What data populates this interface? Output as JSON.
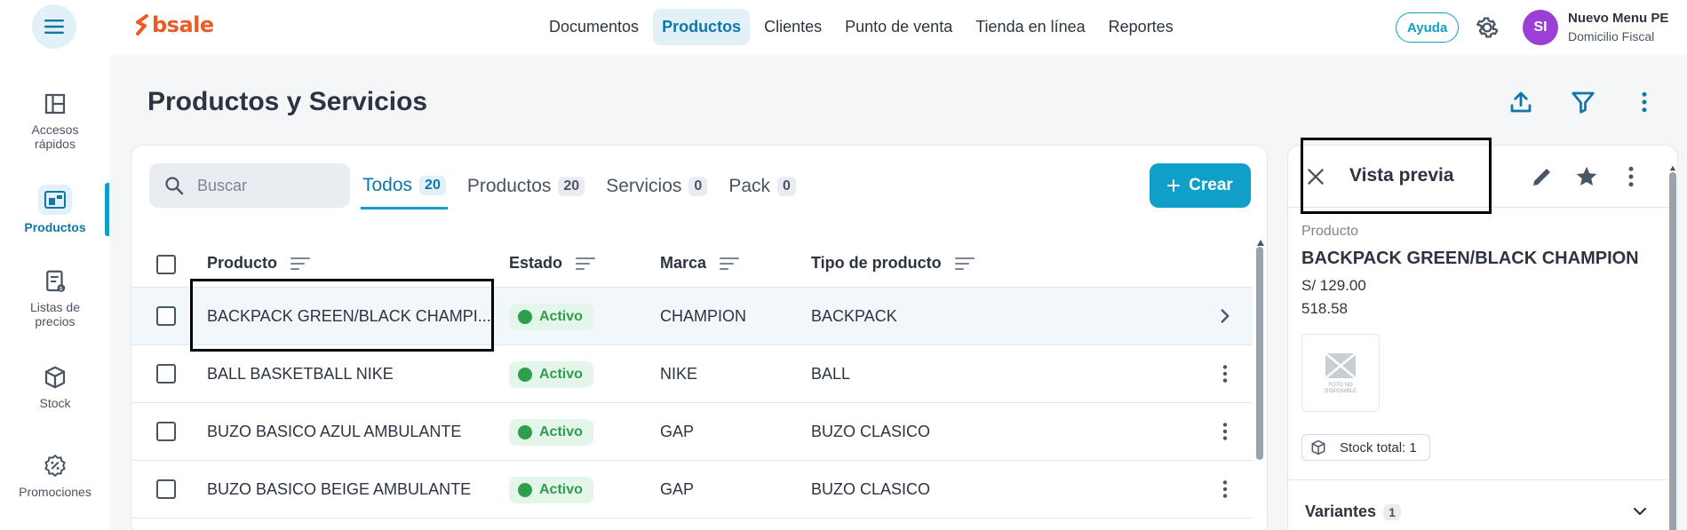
{
  "app": {
    "logo_text": "bsale",
    "brand_color": "#ee5a24",
    "accent_color": "#0f9fc9"
  },
  "nav": {
    "items": [
      {
        "label": "Documentos",
        "active": false
      },
      {
        "label": "Productos",
        "active": true
      },
      {
        "label": "Clientes",
        "active": false
      },
      {
        "label": "Punto de venta",
        "active": false
      },
      {
        "label": "Tienda en línea",
        "active": false
      },
      {
        "label": "Reportes",
        "active": false
      }
    ]
  },
  "header": {
    "help_label": "Ayuda",
    "avatar_initials": "SI",
    "user_name": "Nuevo Menu PE",
    "user_subtitle": "Domicilio Fiscal"
  },
  "sidebar": {
    "items": [
      {
        "label_line1": "Accesos",
        "label_line2": "rápidos",
        "icon": "layout-icon"
      },
      {
        "label_line1": "Productos",
        "label_line2": "",
        "icon": "products-icon",
        "active": true
      },
      {
        "label_line1": "Listas de",
        "label_line2": "precios",
        "icon": "price-list-icon"
      },
      {
        "label_line1": "Stock",
        "label_line2": "",
        "icon": "box-icon"
      },
      {
        "label_line1": "Promociones",
        "label_line2": "",
        "icon": "discount-icon"
      }
    ]
  },
  "page": {
    "title": "Productos y Servicios"
  },
  "search": {
    "placeholder": "Buscar"
  },
  "tabs": [
    {
      "label": "Todos",
      "count": "20",
      "active": true
    },
    {
      "label": "Productos",
      "count": "20",
      "active": false
    },
    {
      "label": "Servicios",
      "count": "0",
      "active": false
    },
    {
      "label": "Pack",
      "count": "0",
      "active": false
    }
  ],
  "create_label": "Crear",
  "table": {
    "columns": [
      "Producto",
      "Estado",
      "Marca",
      "Tipo de producto"
    ],
    "rows": [
      {
        "producto": "BACKPACK GREEN/BLACK CHAMPI...",
        "estado": "Activo",
        "marca": "CHAMPION",
        "tipo": "BACKPACK"
      },
      {
        "producto": "BALL BASKETBALL NIKE",
        "estado": "Activo",
        "marca": "NIKE",
        "tipo": "BALL"
      },
      {
        "producto": "BUZO BASICO AZUL AMBULANTE",
        "estado": "Activo",
        "marca": "GAP",
        "tipo": "BUZO CLASICO"
      },
      {
        "producto": "BUZO BASICO BEIGE AMBULANTE",
        "estado": "Activo",
        "marca": "GAP",
        "tipo": "BUZO CLASICO"
      }
    ]
  },
  "preview": {
    "title": "Vista previa",
    "label": "Producto",
    "name": "BACKPACK GREEN/BLACK CHAMPION",
    "price": "S/ 129.00",
    "cost": "518.58",
    "image_text_line1": "FOTO NO",
    "image_text_line2": "DISPONIBLE",
    "stock_label": "Stock total: 1",
    "variants_label": "Variantes",
    "variants_count": "1"
  }
}
